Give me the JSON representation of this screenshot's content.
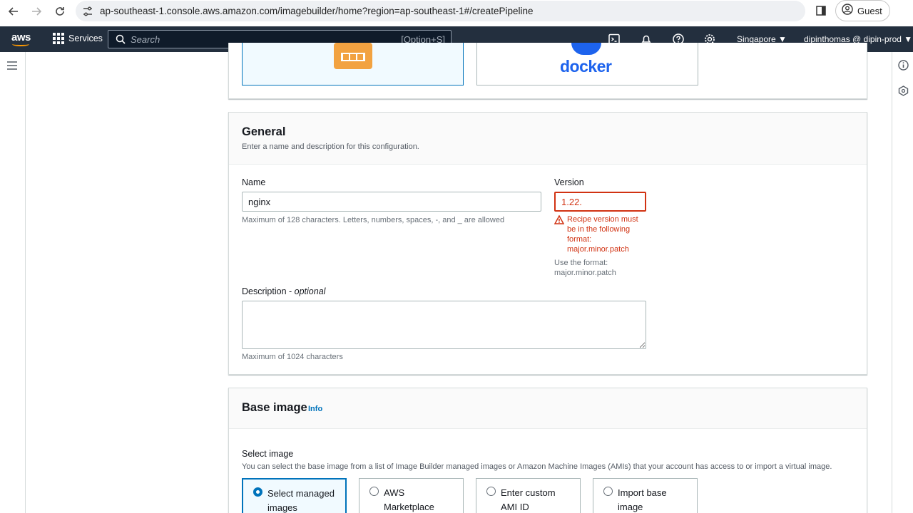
{
  "browser": {
    "url": "ap-southeast-1.console.aws.amazon.com/imagebuilder/home?region=ap-southeast-1#/createPipeline",
    "profile_label": "Guest"
  },
  "aws_nav": {
    "logo_text": "aws",
    "services_label": "Services",
    "search_placeholder": "Search",
    "search_shortcut": "[Option+S]",
    "region_label": "Singapore ▼",
    "user_label": "dipinthomas @ dipin-prod ▼"
  },
  "image_type_cards": {
    "docker_label": "docker"
  },
  "general": {
    "title": "General",
    "subtitle": "Enter a name and description for this configuration.",
    "name_label": "Name",
    "name_value": "nginx",
    "name_hint": "Maximum of 128 characters. Letters, numbers, spaces, -, and _ are allowed",
    "version_label": "Version",
    "version_value": "1.22.",
    "version_error_lines": [
      "Recipe version must",
      "be in the following",
      "format:",
      "major.minor.patch"
    ],
    "version_hint_lines": [
      "Use the format:",
      "major.minor.patch"
    ],
    "description_label": "Description - ",
    "description_optional": "optional",
    "description_value": "",
    "description_hint": "Maximum of 1024 characters"
  },
  "base_image": {
    "title": "Base image",
    "info_label": "Info",
    "select_label": "Select image",
    "select_subtitle": "You can select the base image from a list of Image Builder managed images or Amazon Machine Images (AMIs) that your account has access to or import a virtual image.",
    "options": [
      {
        "label": "Select managed images",
        "selected": true
      },
      {
        "label": "AWS Marketplace",
        "selected": false
      },
      {
        "label": "Enter custom AMI ID",
        "selected": false
      },
      {
        "label": "Import base image",
        "selected": false
      }
    ]
  },
  "colors": {
    "aws_nav_bg": "#232f3e",
    "accent": "#0073bb",
    "error": "#d13212",
    "aws_orange": "#ff9900",
    "docker_blue": "#1d63ed"
  }
}
